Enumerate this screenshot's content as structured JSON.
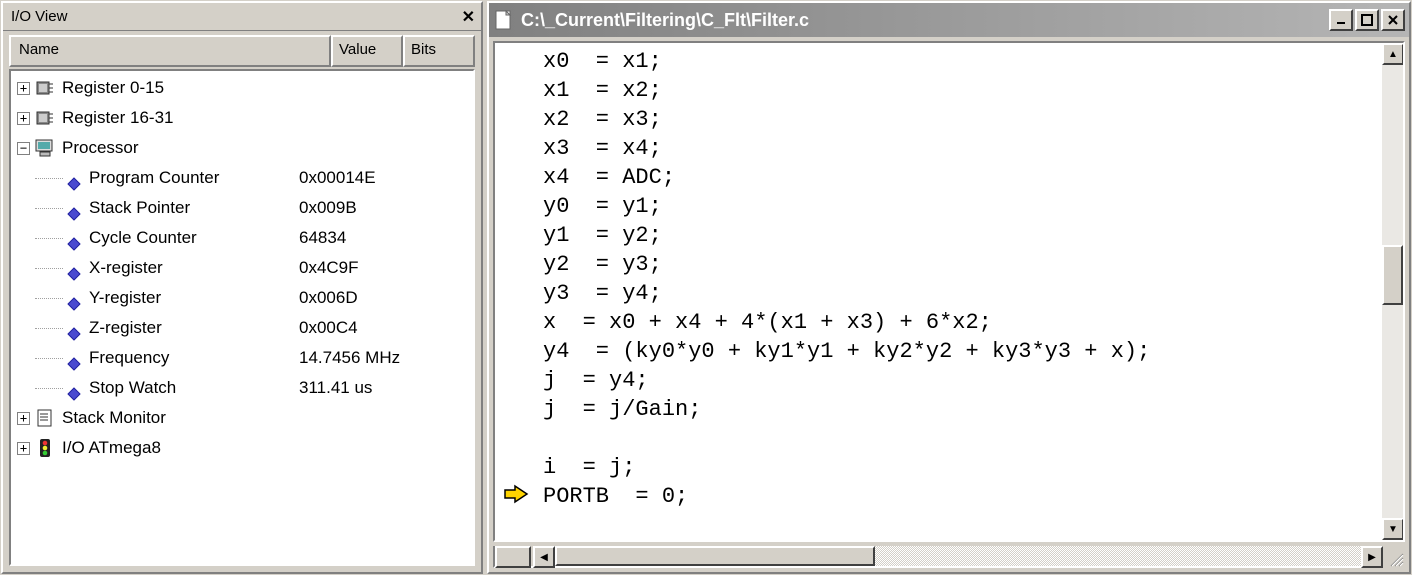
{
  "io_view": {
    "title": "I/O View",
    "columns": {
      "name": "Name",
      "value": "Value",
      "bits": "Bits"
    },
    "tree": {
      "register_0_15": "Register 0-15",
      "register_16_31": "Register 16-31",
      "processor": "Processor",
      "processor_children": [
        {
          "name": "Program Counter",
          "value": "0x00014E"
        },
        {
          "name": "Stack Pointer",
          "value": "0x009B"
        },
        {
          "name": "Cycle Counter",
          "value": "64834"
        },
        {
          "name": "X-register",
          "value": "0x4C9F"
        },
        {
          "name": "Y-register",
          "value": "0x006D"
        },
        {
          "name": "Z-register",
          "value": "0x00C4"
        },
        {
          "name": "Frequency",
          "value": "14.7456 MHz"
        },
        {
          "name": "Stop Watch",
          "value": "311.41 us"
        }
      ],
      "stack_monitor": "Stack Monitor",
      "io_atmega8": "I/O ATmega8"
    },
    "expanders": {
      "plus": "+",
      "minus": "−"
    }
  },
  "code_window": {
    "title": "C:\\_Current\\Filtering\\C_Flt\\Filter.c",
    "execution_line_index": 16,
    "lines": [
      "x0  = x1;",
      "x1  = x2;",
      "x2  = x3;",
      "x3  = x4;",
      "x4  = ADC;",
      "y0  = y1;",
      "y1  = y2;",
      "y2  = y3;",
      "y3  = y4;",
      "x  = x0 + x4 + 4*(x1 + x3) + 6*x2;",
      "y4  = (ky0*y0 + ky1*y1 + ky2*y2 + ky3*y3 + x);",
      "j  = y4;",
      "j  = j/Gain;",
      "",
      "i  = j;",
      "PORTB  = 0;"
    ]
  }
}
